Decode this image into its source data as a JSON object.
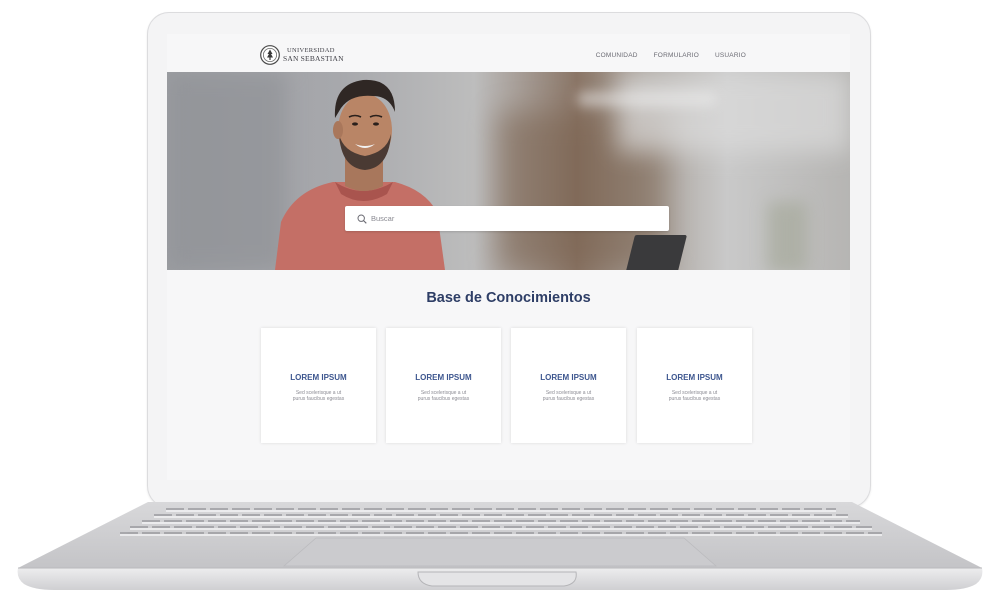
{
  "site": {
    "logo_line1": "UNIVERSIDAD",
    "logo_line2": "SAN SEBASTIAN"
  },
  "nav": {
    "items": [
      "COMUNIDAD",
      "FORMULARIO",
      "USUARIO"
    ]
  },
  "search": {
    "placeholder": "Buscar",
    "icon": "search-icon"
  },
  "section": {
    "title": "Base de Conocimientos"
  },
  "cards": [
    {
      "title": "LOREM IPSUM",
      "desc_line1": "Sed scelerisque a ut",
      "desc_line2": "purus faucibus egestas"
    },
    {
      "title": "LOREM IPSUM",
      "desc_line1": "Sed scelerisque a ut",
      "desc_line2": "purus faucibus egestas"
    },
    {
      "title": "LOREM IPSUM",
      "desc_line1": "Sed scelerisque a ut",
      "desc_line2": "purus faucibus egestas"
    },
    {
      "title": "LOREM IPSUM",
      "desc_line1": "Sed scelerisque a ut",
      "desc_line2": "purus faucibus egestas"
    }
  ],
  "colors": {
    "title": "#2e3e66",
    "card_title": "#3d568f",
    "screen_bg": "#f7f7f8"
  }
}
